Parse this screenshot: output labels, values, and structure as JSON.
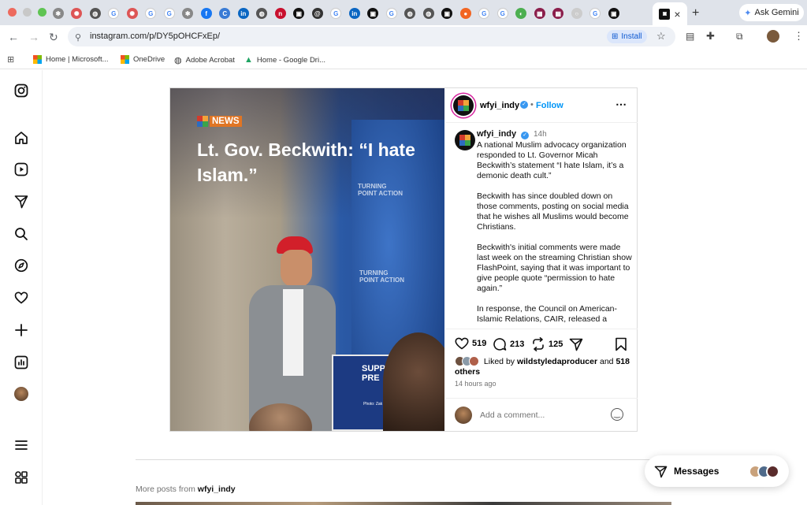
{
  "browser": {
    "tab_favicons": [
      "settings-icon",
      "chat-icon",
      "globe-icon",
      "google-icon",
      "chat-icon",
      "google-icon",
      "google-icon",
      "settings-icon",
      "facebook-icon",
      "c-icon",
      "linkedin-icon",
      "globe-icon",
      "news-icon",
      "wfyi-icon",
      "thread-icon",
      "google-icon",
      "linkedin-icon",
      "wfyi-icon",
      "google-icon",
      "globe-icon",
      "globe-icon",
      "wfyi-icon",
      "orange-icon",
      "google-icon",
      "google-icon",
      "color-icon",
      "grid-icon",
      "grid-icon",
      "circle-icon",
      "google-icon",
      "wfyi-icon"
    ],
    "active_tab_close": "×",
    "new_tab": "+",
    "gemini_label": "Ask Gemini",
    "url": "instagram.com/p/DY5pOHCFxEp/",
    "install_label": "Install",
    "bookmarks": [
      {
        "label": "Home | Microsoft...",
        "icon": "microsoft-icon"
      },
      {
        "label": "OneDrive",
        "icon": "microsoft-icon"
      },
      {
        "label": "Adobe Acrobat",
        "icon": "globe-icon"
      },
      {
        "label": "Home - Google Dri...",
        "icon": "drive-icon"
      }
    ]
  },
  "post": {
    "image": {
      "badge": "NEWS",
      "headline": "Lt. Gov. Beckwith: “I hate Islam.”",
      "sign_text": "SUPP PRE",
      "photo_credit": "Photo: Zak Cassel / WFYI",
      "banner_text": "TURNING POINT ACTION"
    },
    "author": "wfyi_indy",
    "follow_label": "Follow",
    "time": "14h",
    "caption": [
      "A national Muslim advocacy organization responded to Lt. Governor Micah Beckwith’s statement “I hate Islam, it’s a demonic death cult.”",
      "Beckwith has since doubled down on those comments, posting on social media that he wishes all Muslims would become Christians.",
      "Beckwith's initial comments were made last week on the streaming Christian show FlashPoint, saying that it was important to give people quote “permission to hate again.”",
      "In response, the Council on American-Islamic Relations, CAIR, released a"
    ],
    "likes_count": "519",
    "comments_count": "213",
    "reposts_count": "125",
    "liked_by_prefix": "Liked by",
    "liked_by_user": "wildstyledaproducer",
    "liked_by_and": "and",
    "liked_by_others": "518 others",
    "posted_ago": "14 hours ago",
    "comment_placeholder": "Add a comment..."
  },
  "more_posts": {
    "prefix": "More posts from",
    "user": "wfyi_indy"
  },
  "messages_label": "Messages"
}
